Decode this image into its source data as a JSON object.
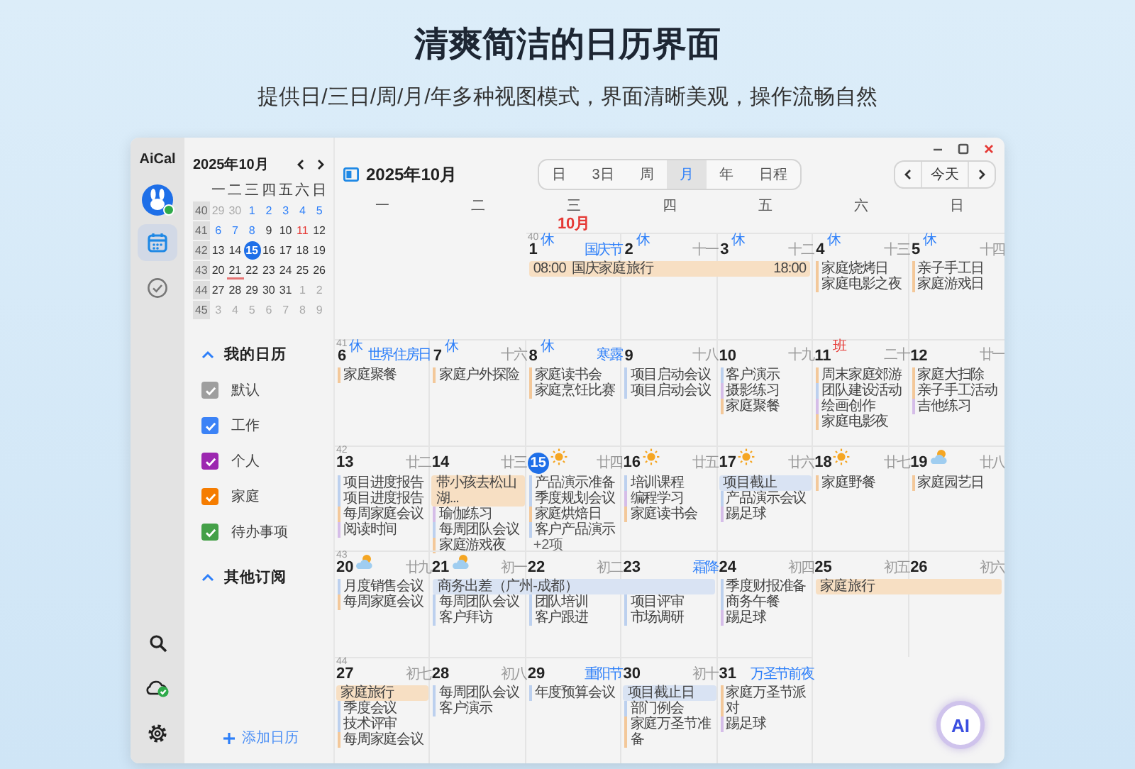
{
  "heading": {
    "title": "清爽简洁的日历界面",
    "subtitle": "提供日/三日/周/月/年多种视图模式，界面清晰美观，操作流畅自然"
  },
  "app": {
    "name": "AiCal"
  },
  "rail": {
    "avatar": {
      "online": true
    },
    "items": [
      {
        "kind": "calendar",
        "selected": true
      },
      {
        "kind": "tasks",
        "selected": false
      }
    ],
    "bottom": [
      {
        "kind": "search"
      },
      {
        "kind": "sync"
      },
      {
        "kind": "settings"
      }
    ]
  },
  "mini_calendar": {
    "title": "2025年10月",
    "weekdays": [
      "一",
      "二",
      "三",
      "四",
      "五",
      "六",
      "日"
    ],
    "weeks": [
      {
        "week": "40",
        "days": [
          {
            "d": "29",
            "kind": "other",
            "selected": false,
            "underlined": false
          },
          {
            "d": "30",
            "kind": "other",
            "selected": false,
            "underlined": false
          },
          {
            "d": "1",
            "kind": "rest",
            "selected": false,
            "underlined": false
          },
          {
            "d": "2",
            "kind": "rest",
            "selected": false,
            "underlined": false
          },
          {
            "d": "3",
            "kind": "rest",
            "selected": false,
            "underlined": false
          },
          {
            "d": "4",
            "kind": "rest",
            "selected": false,
            "underlined": false
          },
          {
            "d": "5",
            "kind": "rest",
            "selected": false,
            "underlined": false
          }
        ]
      },
      {
        "week": "41",
        "days": [
          {
            "d": "6",
            "kind": "rest",
            "selected": false,
            "underlined": false
          },
          {
            "d": "7",
            "kind": "rest",
            "selected": false,
            "underlined": false
          },
          {
            "d": "8",
            "kind": "rest",
            "selected": false,
            "underlined": false
          },
          {
            "d": "9",
            "kind": "normal",
            "selected": false,
            "underlined": false
          },
          {
            "d": "10",
            "kind": "normal",
            "selected": false,
            "underlined": false
          },
          {
            "d": "11",
            "kind": "work",
            "selected": false,
            "underlined": false
          },
          {
            "d": "12",
            "kind": "normal",
            "selected": false,
            "underlined": false
          }
        ]
      },
      {
        "week": "42",
        "days": [
          {
            "d": "13",
            "kind": "normal",
            "selected": false,
            "underlined": false
          },
          {
            "d": "14",
            "kind": "normal",
            "selected": false,
            "underlined": false
          },
          {
            "d": "15",
            "kind": "normal",
            "selected": true,
            "underlined": false
          },
          {
            "d": "16",
            "kind": "normal",
            "selected": false,
            "underlined": false
          },
          {
            "d": "17",
            "kind": "normal",
            "selected": false,
            "underlined": false
          },
          {
            "d": "18",
            "kind": "normal",
            "selected": false,
            "underlined": false
          },
          {
            "d": "19",
            "kind": "normal",
            "selected": false,
            "underlined": false
          }
        ]
      },
      {
        "week": "43",
        "days": [
          {
            "d": "20",
            "kind": "normal",
            "selected": false,
            "underlined": false
          },
          {
            "d": "21",
            "kind": "normal",
            "selected": false,
            "underlined": true
          },
          {
            "d": "22",
            "kind": "normal",
            "selected": false,
            "underlined": false
          },
          {
            "d": "23",
            "kind": "normal",
            "selected": false,
            "underlined": false
          },
          {
            "d": "24",
            "kind": "normal",
            "selected": false,
            "underlined": false
          },
          {
            "d": "25",
            "kind": "normal",
            "selected": false,
            "underlined": false
          },
          {
            "d": "26",
            "kind": "normal",
            "selected": false,
            "underlined": false
          }
        ]
      },
      {
        "week": "44",
        "days": [
          {
            "d": "27",
            "kind": "normal",
            "selected": false,
            "underlined": false
          },
          {
            "d": "28",
            "kind": "normal",
            "selected": false,
            "underlined": false
          },
          {
            "d": "29",
            "kind": "normal",
            "selected": false,
            "underlined": false
          },
          {
            "d": "30",
            "kind": "normal",
            "selected": false,
            "underlined": false
          },
          {
            "d": "31",
            "kind": "normal",
            "selected": false,
            "underlined": false
          },
          {
            "d": "1",
            "kind": "other",
            "selected": false,
            "underlined": false
          },
          {
            "d": "2",
            "kind": "other",
            "selected": false,
            "underlined": false
          }
        ]
      },
      {
        "week": "45",
        "days": [
          {
            "d": "3",
            "kind": "other",
            "selected": false,
            "underlined": false
          },
          {
            "d": "4",
            "kind": "other",
            "selected": false,
            "underlined": false
          },
          {
            "d": "5",
            "kind": "other",
            "selected": false,
            "underlined": false
          },
          {
            "d": "6",
            "kind": "other",
            "selected": false,
            "underlined": false
          },
          {
            "d": "7",
            "kind": "other",
            "selected": false,
            "underlined": false
          },
          {
            "d": "8",
            "kind": "other",
            "selected": false,
            "underlined": false
          },
          {
            "d": "9",
            "kind": "other",
            "selected": false,
            "underlined": false
          }
        ]
      }
    ]
  },
  "calendar_sections": [
    {
      "title": "我的日历",
      "expanded": true,
      "calendars": [
        {
          "name": "默认",
          "color": "#9e9e9e",
          "checked": true
        },
        {
          "name": "工作",
          "color": "#3b82f6",
          "checked": true
        },
        {
          "name": "个人",
          "color": "#9c27b0",
          "checked": true
        },
        {
          "name": "家庭",
          "color": "#f57c00",
          "checked": true
        },
        {
          "name": "待办事项",
          "color": "#43a047",
          "checked": true
        }
      ]
    },
    {
      "title": "其他订阅",
      "expanded": true
    }
  ],
  "add_calendar": {
    "label": "添加日历"
  },
  "toolbar": {
    "title": "2025年10月",
    "views": [
      {
        "label": "日",
        "selected": false
      },
      {
        "label": "3日",
        "selected": false
      },
      {
        "label": "周",
        "selected": false
      },
      {
        "label": "月",
        "selected": true
      },
      {
        "label": "年",
        "selected": false
      },
      {
        "label": "日程",
        "selected": false
      }
    ],
    "today": "今天"
  },
  "weekdays": [
    "一",
    "二",
    "三",
    "四",
    "五",
    "六",
    "日"
  ],
  "month_label": "10月",
  "weeks": [
    {
      "days": [
        {
          "kind": "blank"
        },
        {
          "kind": "blank"
        },
        {
          "kind": "day",
          "week": "40",
          "date": "1",
          "badge": {
            "text": "休",
            "kind": "rest"
          },
          "note": "国庆节",
          "festival": true,
          "today": false,
          "events": [
            {
              "kind": "span",
              "time": "08:00",
              "text": "国庆家庭旅行",
              "color": "#f7dfc3"
            }
          ]
        },
        {
          "kind": "day",
          "date": "2",
          "badge": {
            "text": "休",
            "kind": "rest"
          },
          "note": "十一",
          "festival": false,
          "today": false,
          "events": [
            {
              "kind": "continued"
            }
          ]
        },
        {
          "kind": "day",
          "date": "3",
          "badge": {
            "text": "休",
            "kind": "rest"
          },
          "note": "十二",
          "festival": false,
          "today": false,
          "events": [
            {
              "kind": "continued",
              "end": "18:00"
            }
          ]
        },
        {
          "kind": "day",
          "date": "4",
          "badge": {
            "text": "休",
            "kind": "rest"
          },
          "note": "十三",
          "festival": false,
          "today": false,
          "events": [
            {
              "kind": "line",
              "text": "家庭烧烤日",
              "color": "#f3c89a"
            },
            {
              "kind": "line",
              "text": "家庭电影之夜",
              "color": "#f3c89a"
            }
          ]
        },
        {
          "kind": "day",
          "date": "5",
          "badge": {
            "text": "休",
            "kind": "rest"
          },
          "note": "十四",
          "festival": false,
          "today": false,
          "events": [
            {
              "kind": "line",
              "text": "亲子手工日",
              "color": "#f3c89a"
            },
            {
              "kind": "line",
              "text": "家庭游戏日",
              "color": "#f3c89a"
            }
          ]
        }
      ]
    },
    {
      "days": [
        {
          "kind": "day",
          "week": "41",
          "date": "6",
          "badge": {
            "text": "休",
            "kind": "rest"
          },
          "note": "世界住房日",
          "festival": true,
          "today": false,
          "events": [
            {
              "kind": "line",
              "text": "家庭聚餐",
              "color": "#f3c89a"
            }
          ]
        },
        {
          "kind": "day",
          "date": "7",
          "badge": {
            "text": "休",
            "kind": "rest"
          },
          "note": "十六",
          "festival": false,
          "today": false,
          "events": [
            {
              "kind": "line",
              "text": "家庭户外探险",
              "color": "#f3c89a"
            }
          ]
        },
        {
          "kind": "day",
          "date": "8",
          "badge": {
            "text": "休",
            "kind": "rest"
          },
          "note": "寒露",
          "festival": true,
          "today": false,
          "events": [
            {
              "kind": "line",
              "text": "家庭读书会",
              "color": "#f3c89a"
            },
            {
              "kind": "line",
              "text": "家庭烹饪比赛",
              "color": "#f3c89a"
            }
          ]
        },
        {
          "kind": "day",
          "date": "9",
          "note": "十八",
          "festival": false,
          "today": false,
          "events": [
            {
              "kind": "line",
              "text": "项目启动会议",
              "color": "#bcd0ee"
            },
            {
              "kind": "line",
              "text": "项目启动会议",
              "color": "#bcd0ee"
            }
          ]
        },
        {
          "kind": "day",
          "date": "10",
          "note": "十九",
          "festival": false,
          "today": false,
          "events": [
            {
              "kind": "line",
              "text": "客户演示",
              "color": "#bcd0ee"
            },
            {
              "kind": "line",
              "text": "摄影练习",
              "color": "#d5bde8"
            },
            {
              "kind": "line",
              "text": "家庭聚餐",
              "color": "#f3c89a"
            }
          ]
        },
        {
          "kind": "day",
          "date": "11",
          "badge": {
            "text": "班",
            "kind": "work"
          },
          "note": "二十",
          "festival": false,
          "today": false,
          "events": [
            {
              "kind": "line",
              "text": "周末家庭郊游",
              "color": "#f3c89a"
            },
            {
              "kind": "line",
              "text": "团队建设活动",
              "color": "#bcd0ee"
            },
            {
              "kind": "line",
              "text": "绘画创作",
              "color": "#d5bde8"
            },
            {
              "kind": "line",
              "text": "家庭电影夜",
              "color": "#f3c89a"
            }
          ]
        },
        {
          "kind": "day",
          "date": "12",
          "note": "廿一",
          "festival": false,
          "today": false,
          "events": [
            {
              "kind": "line",
              "text": "家庭大扫除",
              "color": "#f3c89a"
            },
            {
              "kind": "line",
              "text": "亲子手工活动",
              "color": "#f3c89a"
            },
            {
              "kind": "line",
              "text": "吉他练习",
              "color": "#d5bde8"
            }
          ]
        }
      ]
    },
    {
      "days": [
        {
          "kind": "day",
          "week": "42",
          "date": "13",
          "note": "廿二",
          "festival": false,
          "today": false,
          "events": [
            {
              "kind": "line",
              "text": "项目进度报告",
              "color": "#bcd0ee"
            },
            {
              "kind": "line",
              "text": "项目进度报告",
              "color": "#bcd0ee"
            },
            {
              "kind": "line",
              "text": "每周家庭会议",
              "color": "#f3c89a"
            },
            {
              "kind": "line",
              "text": "阅读时间",
              "color": "#d5bde8"
            }
          ]
        },
        {
          "kind": "day",
          "date": "14",
          "note": "廿三",
          "festival": false,
          "today": false,
          "events": [
            {
              "kind": "bar",
              "text": "带小孩去松山湖...",
              "color": "#f7dfc3"
            },
            {
              "kind": "line",
              "text": "瑜伽练习",
              "color": "#d5bde8"
            },
            {
              "kind": "line",
              "text": "每周团队会议",
              "color": "#bcd0ee"
            },
            {
              "kind": "line",
              "text": "家庭游戏夜",
              "color": "#f3c89a"
            }
          ]
        },
        {
          "kind": "day",
          "date": "15",
          "weather": {
            "kind": "sunny"
          },
          "note": "廿四",
          "festival": false,
          "today": true,
          "events": [
            {
              "kind": "line",
              "text": "产品演示准备",
              "color": "#bcd0ee"
            },
            {
              "kind": "line",
              "text": "季度规划会议",
              "color": "#bcd0ee"
            },
            {
              "kind": "line",
              "text": "家庭烘焙日",
              "color": "#f3c89a"
            },
            {
              "kind": "line",
              "text": "客户产品演示",
              "color": "#bcd0ee"
            },
            {
              "kind": "more",
              "text": "+2项"
            }
          ]
        },
        {
          "kind": "day",
          "date": "16",
          "weather": {
            "kind": "sunny"
          },
          "note": "廿五",
          "festival": false,
          "today": false,
          "events": [
            {
              "kind": "line",
              "text": "培训课程",
              "color": "#bcd0ee"
            },
            {
              "kind": "line",
              "text": "编程学习",
              "color": "#d5bde8"
            },
            {
              "kind": "line",
              "text": "家庭读书会",
              "color": "#f3c89a"
            }
          ]
        },
        {
          "kind": "day",
          "date": "17",
          "weather": {
            "kind": "sunny"
          },
          "note": "廿六",
          "festival": false,
          "today": false,
          "events": [
            {
              "kind": "bar",
              "text": "项目截止",
              "color": "#d9e3f3"
            },
            {
              "kind": "line",
              "text": "产品演示会议",
              "color": "#bcd0ee"
            },
            {
              "kind": "line",
              "text": "踢足球",
              "color": "#d5bde8"
            }
          ]
        },
        {
          "kind": "day",
          "date": "18",
          "weather": {
            "kind": "sunny"
          },
          "note": "廿七",
          "festival": false,
          "today": false,
          "events": [
            {
              "kind": "line",
              "text": "家庭野餐",
              "color": "#f3c89a"
            }
          ]
        },
        {
          "kind": "day",
          "date": "19",
          "weather": {
            "kind": "cloudy"
          },
          "note": "廿八",
          "festival": false,
          "today": false,
          "events": [
            {
              "kind": "line",
              "text": "家庭园艺日",
              "color": "#f3c89a"
            }
          ]
        }
      ]
    },
    {
      "days": [
        {
          "kind": "day",
          "week": "43",
          "date": "20",
          "weather": {
            "kind": "cloudy"
          },
          "note": "廿九",
          "festival": false,
          "today": false,
          "events": [
            {
              "kind": "line",
              "text": "月度销售会议",
              "color": "#bcd0ee"
            },
            {
              "kind": "line",
              "text": "每周家庭会议",
              "color": "#f3c89a"
            }
          ]
        },
        {
          "kind": "day",
          "date": "21",
          "weather": {
            "kind": "cloudy"
          },
          "note": "初一",
          "festival": false,
          "today": false,
          "events": [
            {
              "kind": "span",
              "text": "商务出差（广州-成都）",
              "color": "#d9e3f3"
            },
            {
              "kind": "line",
              "text": "每周团队会议",
              "color": "#bcd0ee"
            },
            {
              "kind": "line",
              "text": "客户拜访",
              "color": "#bcd0ee"
            }
          ]
        },
        {
          "kind": "day",
          "date": "22",
          "note": "初二",
          "festival": false,
          "today": false,
          "events": [
            {
              "kind": "continued"
            },
            {
              "kind": "line",
              "text": "团队培训",
              "color": "#bcd0ee"
            },
            {
              "kind": "line",
              "text": "客户跟进",
              "color": "#bcd0ee"
            }
          ]
        },
        {
          "kind": "day",
          "date": "23",
          "note": "霜降",
          "festival": true,
          "today": false,
          "events": [
            {
              "kind": "continued"
            },
            {
              "kind": "line",
              "text": "项目评审",
              "color": "#bcd0ee"
            },
            {
              "kind": "line",
              "text": "市场调研",
              "color": "#bcd0ee"
            }
          ]
        },
        {
          "kind": "day",
          "date": "24",
          "note": "初四",
          "festival": false,
          "today": false,
          "events": [
            {
              "kind": "line",
              "text": "季度财报准备",
              "color": "#bcd0ee"
            },
            {
              "kind": "line",
              "text": "商务午餐",
              "color": "#bcd0ee"
            },
            {
              "kind": "line",
              "text": "踢足球",
              "color": "#d5bde8"
            }
          ]
        },
        {
          "kind": "day",
          "date": "25",
          "note": "初五",
          "festival": false,
          "today": false,
          "events": [
            {
              "kind": "span",
              "text": "家庭旅行",
              "color": "#f7dfc3"
            }
          ]
        },
        {
          "kind": "day",
          "date": "26",
          "note": "初六",
          "festival": false,
          "today": false,
          "events": [
            {
              "kind": "continued"
            }
          ]
        }
      ]
    },
    {
      "days": [
        {
          "kind": "day",
          "week": "44",
          "date": "27",
          "note": "初七",
          "festival": false,
          "today": false,
          "events": [
            {
              "kind": "bar",
              "text": "家庭旅行",
              "color": "#f7dfc3"
            },
            {
              "kind": "line",
              "text": "季度会议",
              "color": "#bcd0ee"
            },
            {
              "kind": "line",
              "text": "技术评审",
              "color": "#bcd0ee"
            },
            {
              "kind": "line",
              "text": "每周家庭会议",
              "color": "#f3c89a"
            }
          ]
        },
        {
          "kind": "day",
          "date": "28",
          "note": "初八",
          "festival": false,
          "today": false,
          "events": [
            {
              "kind": "line",
              "text": "每周团队会议",
              "color": "#bcd0ee"
            },
            {
              "kind": "line",
              "text": "客户演示",
              "color": "#bcd0ee"
            }
          ]
        },
        {
          "kind": "day",
          "date": "29",
          "note": "重阳节",
          "festival": true,
          "today": false,
          "events": [
            {
              "kind": "line",
              "text": "年度预算会议",
              "color": "#bcd0ee"
            }
          ]
        },
        {
          "kind": "day",
          "date": "30",
          "note": "初十",
          "festival": false,
          "today": false,
          "events": [
            {
              "kind": "bar",
              "text": "项目截止日",
              "color": "#d9e3f3"
            },
            {
              "kind": "line",
              "text": "部门例会",
              "color": "#bcd0ee"
            },
            {
              "kind": "line",
              "text": "家庭万圣节准备",
              "color": "#f3c89a"
            }
          ]
        },
        {
          "kind": "day",
          "date": "31",
          "note": "万圣节前夜",
          "festival": true,
          "today": false,
          "events": [
            {
              "kind": "line",
              "text": "家庭万圣节派对",
              "color": "#f3c89a"
            },
            {
              "kind": "line",
              "text": "踢足球",
              "color": "#d5bde8"
            }
          ]
        },
        {
          "kind": "blank"
        },
        {
          "kind": "blank"
        }
      ]
    }
  ],
  "ai_button": {
    "label": "AI"
  }
}
